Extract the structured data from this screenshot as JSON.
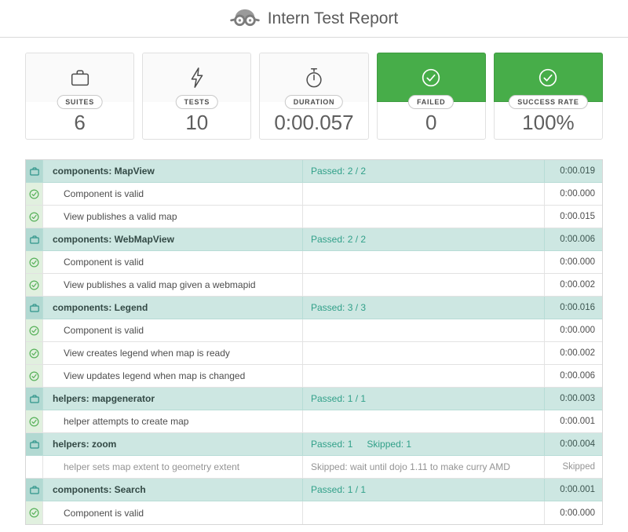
{
  "header": {
    "title": "Intern Test Report",
    "logo_icon": "intern-goggles-icon"
  },
  "summary": {
    "cards": [
      {
        "label": "SUITES",
        "value": "6",
        "icon": "briefcase-icon",
        "variant": "neutral"
      },
      {
        "label": "TESTS",
        "value": "10",
        "icon": "lightning-bolt-icon",
        "variant": "neutral"
      },
      {
        "label": "DURATION",
        "value": "0:00.057",
        "icon": "stopwatch-icon",
        "variant": "neutral"
      },
      {
        "label": "FAILED",
        "value": "0",
        "icon": "check-circle-icon",
        "variant": "success"
      },
      {
        "label": "SUCCESS RATE",
        "value": "100%",
        "icon": "check-circle-icon",
        "variant": "success"
      }
    ]
  },
  "colors": {
    "success_green": "#47ad49",
    "suite_row_teal": "#cde7e2",
    "suite_icon_cell_teal": "#b2d9d2",
    "passed_text": "#31a089",
    "test_icon_cell_green": "#e1f0df"
  },
  "table": {
    "icons": {
      "suite": "briefcase-icon",
      "passed_test": "check-circle-icon"
    },
    "rows": [
      {
        "type": "suite",
        "name": "components: MapView",
        "status": "Passed: 2 / 2",
        "status2": "",
        "duration": "0:00.019"
      },
      {
        "type": "test",
        "name": "Component is valid",
        "status": "",
        "status2": "",
        "duration": "0:00.000"
      },
      {
        "type": "test",
        "name": "View publishes a valid map",
        "status": "",
        "status2": "",
        "duration": "0:00.015"
      },
      {
        "type": "suite",
        "name": "components: WebMapView",
        "status": "Passed: 2 / 2",
        "status2": "",
        "duration": "0:00.006"
      },
      {
        "type": "test",
        "name": "Component is valid",
        "status": "",
        "status2": "",
        "duration": "0:00.000"
      },
      {
        "type": "test",
        "name": "View publishes a valid map given a webmapid",
        "status": "",
        "status2": "",
        "duration": "0:00.002"
      },
      {
        "type": "suite",
        "name": "components: Legend",
        "status": "Passed: 3 / 3",
        "status2": "",
        "duration": "0:00.016"
      },
      {
        "type": "test",
        "name": "Component is valid",
        "status": "",
        "status2": "",
        "duration": "0:00.000"
      },
      {
        "type": "test",
        "name": "View creates legend when map is ready",
        "status": "",
        "status2": "",
        "duration": "0:00.002"
      },
      {
        "type": "test",
        "name": "View updates legend when map is changed",
        "status": "",
        "status2": "",
        "duration": "0:00.006"
      },
      {
        "type": "suite",
        "name": "helpers: mapgenerator",
        "status": "Passed: 1 / 1",
        "status2": "",
        "duration": "0:00.003"
      },
      {
        "type": "test",
        "name": "helper attempts to create map",
        "status": "",
        "status2": "",
        "duration": "0:00.001"
      },
      {
        "type": "suite",
        "name": "helpers: zoom",
        "status": "Passed: 1",
        "status2": "Skipped: 1",
        "duration": "0:00.004"
      },
      {
        "type": "skipped",
        "name": "helper sets map extent to geometry extent",
        "status": "Skipped: wait until dojo 1.11 to make curry AMD",
        "status2": "",
        "duration": "Skipped"
      },
      {
        "type": "suite",
        "name": "components: Search",
        "status": "Passed: 1 / 1",
        "status2": "",
        "duration": "0:00.001"
      },
      {
        "type": "test",
        "name": "Component is valid",
        "status": "",
        "status2": "",
        "duration": "0:00.000"
      }
    ]
  }
}
